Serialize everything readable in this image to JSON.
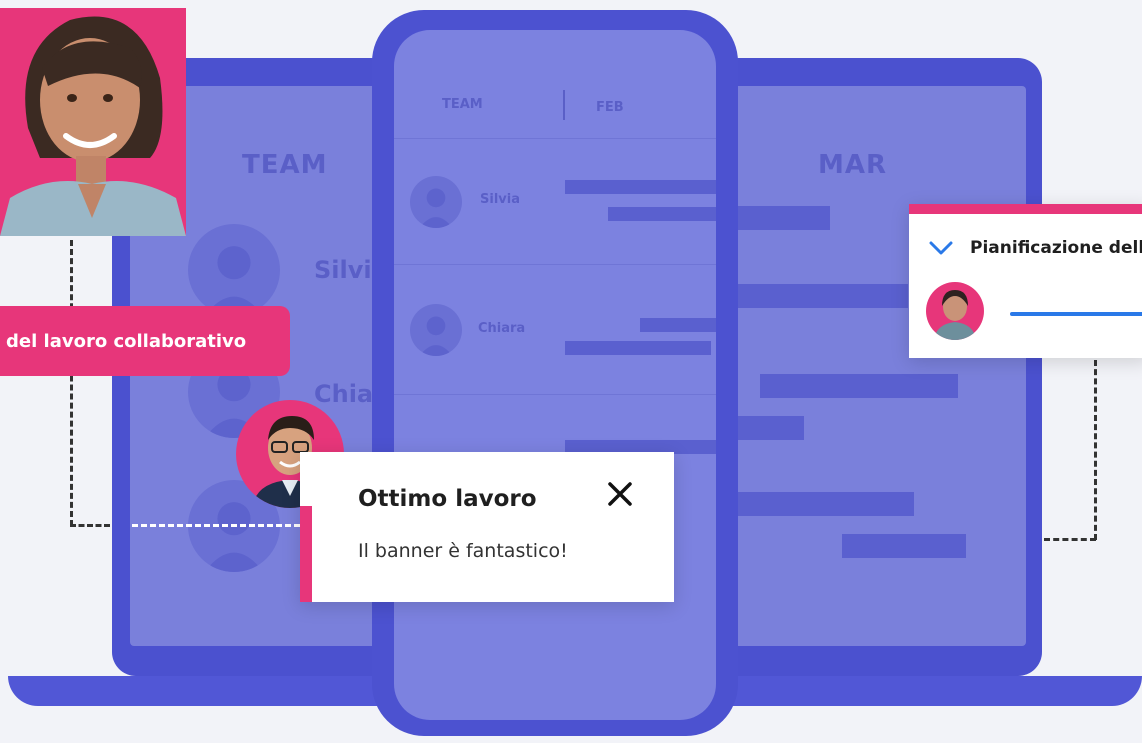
{
  "laptop": {
    "team_header": "TEAM",
    "month_header": "MAR",
    "members": [
      {
        "name": "Silvia"
      },
      {
        "name": "Chiara"
      }
    ]
  },
  "phone": {
    "team_header": "TEAM",
    "month_header": "FEB",
    "members": [
      {
        "name": "Silvia"
      },
      {
        "name": "Chiara"
      }
    ]
  },
  "label_banner": "del lavoro collaborativo",
  "toast": {
    "title": "Ottimo lavoro",
    "message": "Il banner è fantastico!",
    "close_icon": "close-icon"
  },
  "planning_card": {
    "title": "Pianificazione dell",
    "icon": "chevron-down-icon",
    "progress_color": "#2a79e8"
  },
  "colors": {
    "brand_pink": "#e7367a",
    "brand_indigo": "#4b51cf",
    "screen_lilac": "#7a80db"
  }
}
